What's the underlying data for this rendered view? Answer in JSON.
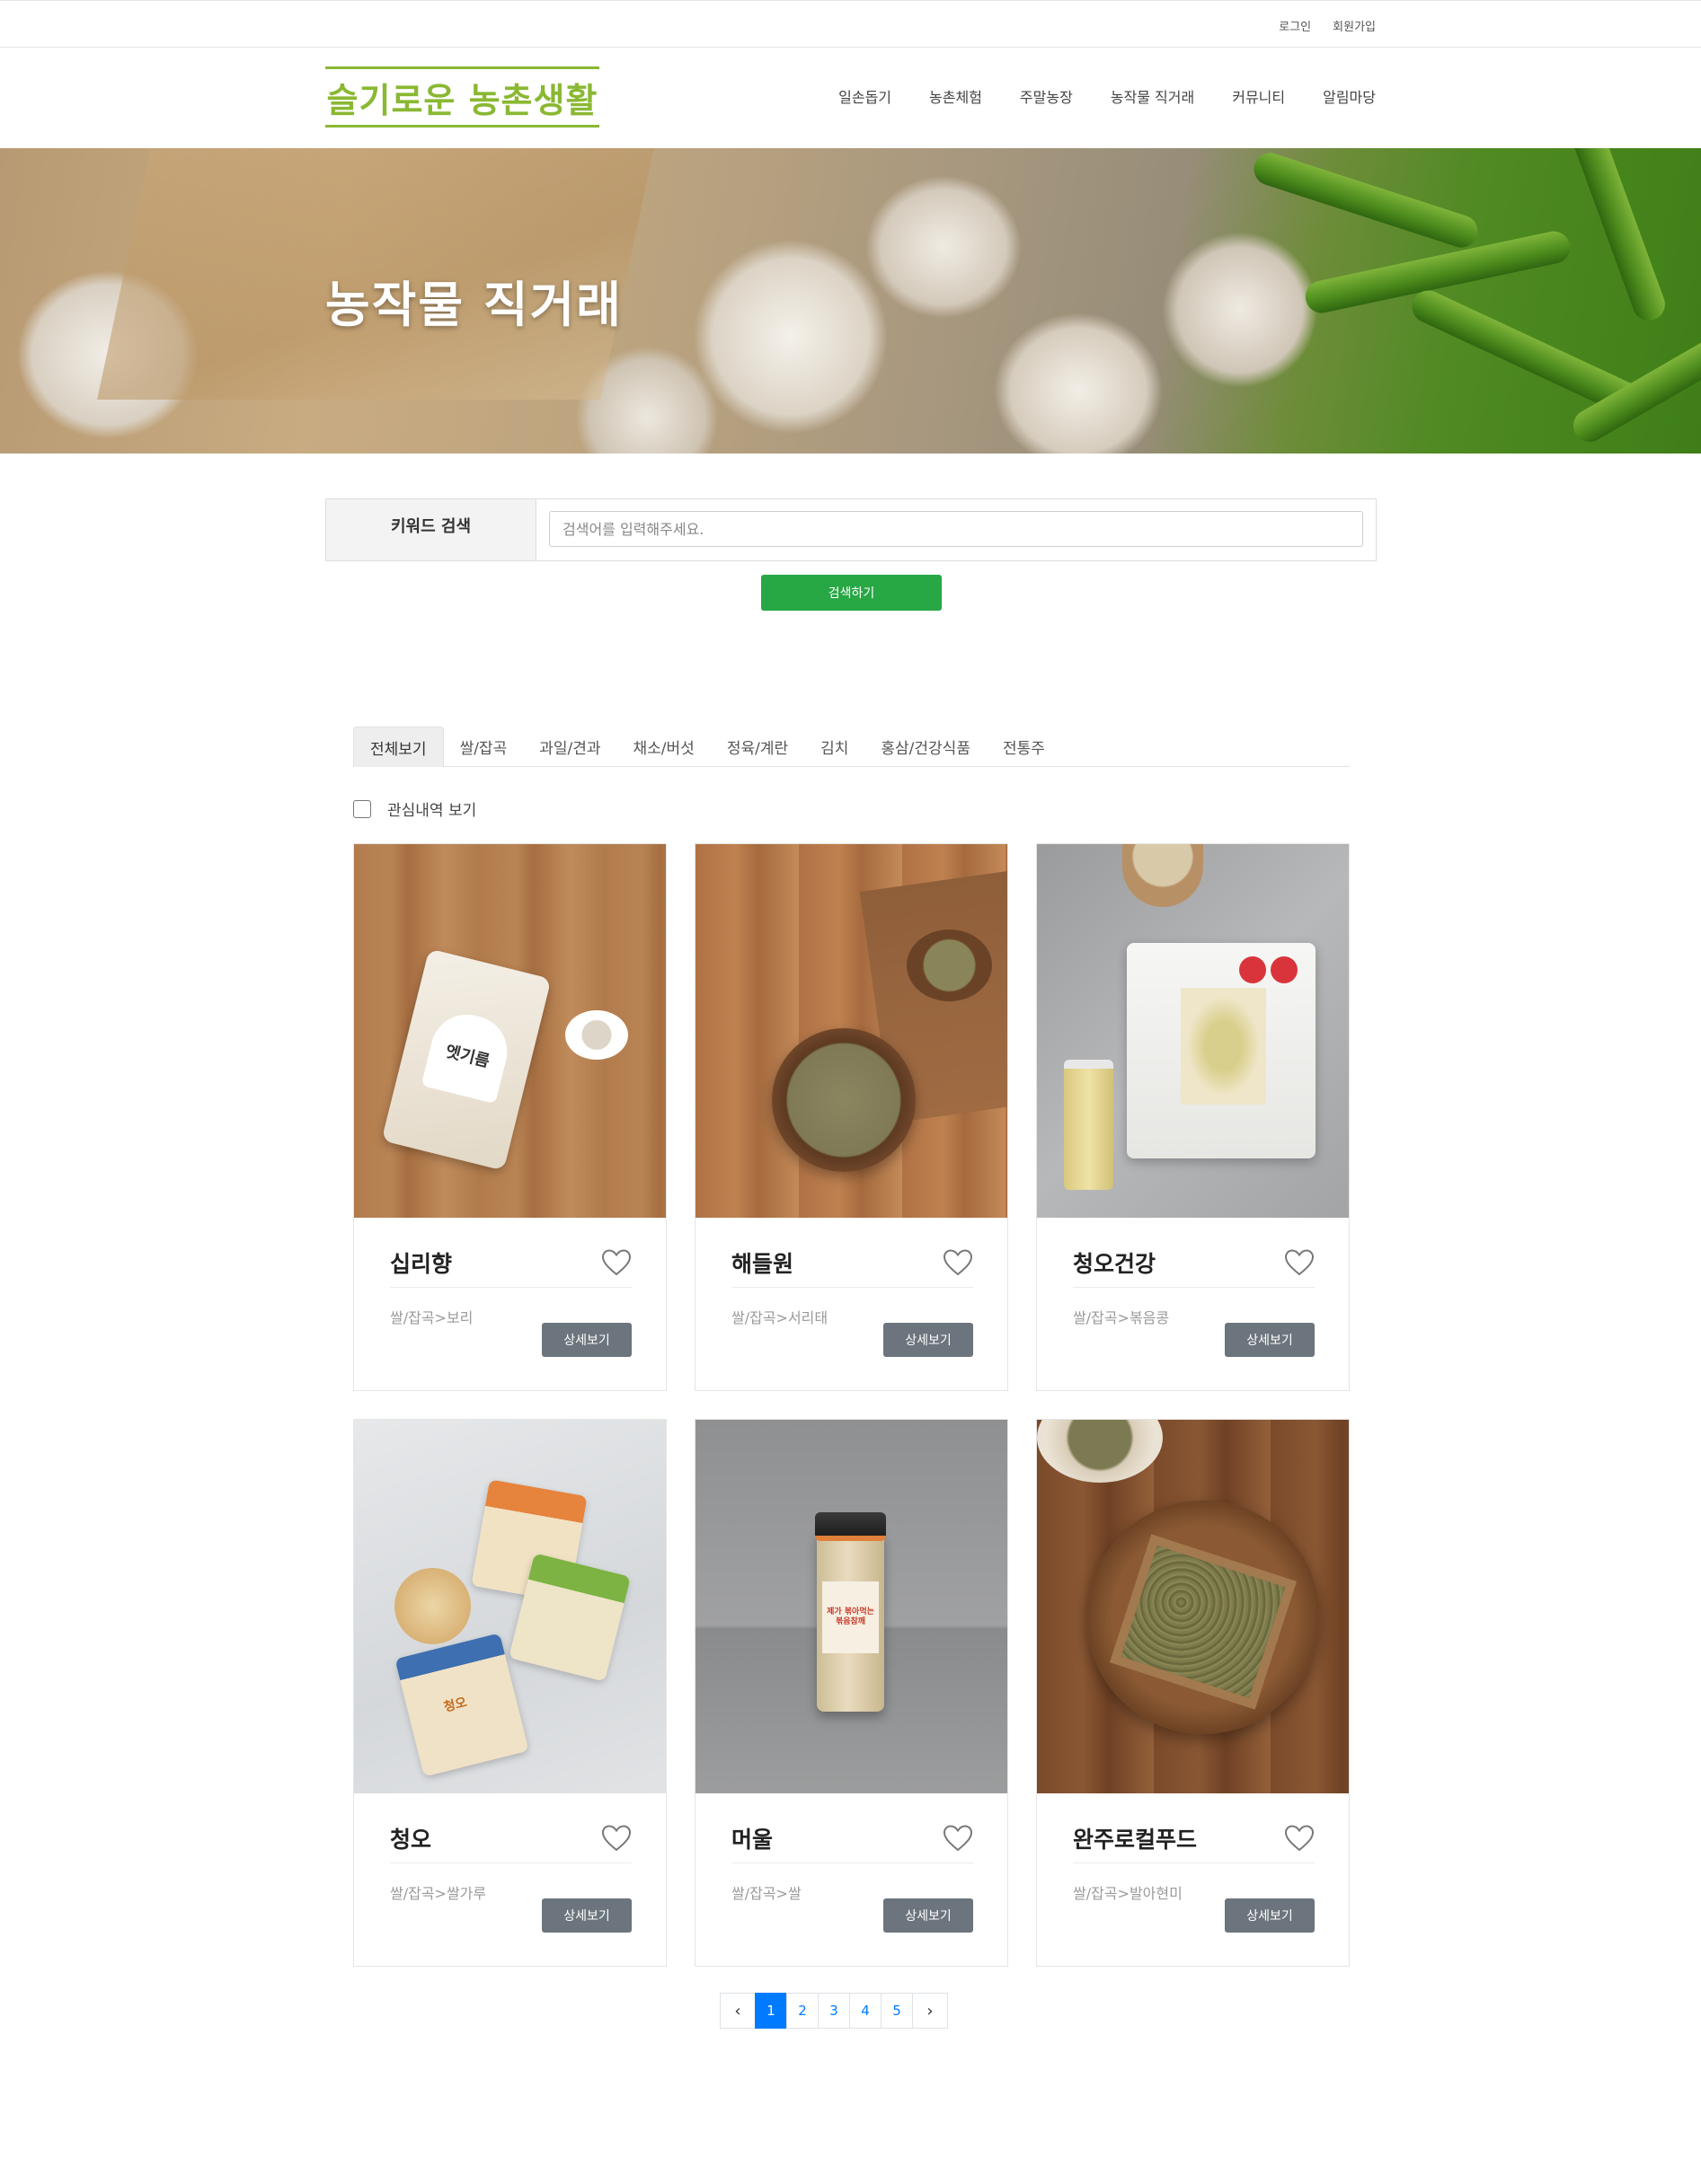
{
  "topbar": {
    "login": "로그인",
    "signup": "회원가입"
  },
  "header": {
    "logo": "슬기로운 농촌생활",
    "nav": [
      "일손돕기",
      "농촌체험",
      "주말농장",
      "농작물 직거래",
      "커뮤니티",
      "알림마당"
    ]
  },
  "hero": {
    "title": "농작물 직거래"
  },
  "search": {
    "label": "키워드 검색",
    "placeholder": "검색어를 입력해주세요.",
    "button": "검색하기"
  },
  "tabs": [
    "전체보기",
    "쌀/잡곡",
    "과일/견과",
    "채소/버섯",
    "정육/계란",
    "김치",
    "홍삼/건강식품",
    "전통주"
  ],
  "interest_label": "관심내역 보기",
  "products": [
    {
      "name": "십리향",
      "category": "쌀/잡곡>보리",
      "button": "상세보기"
    },
    {
      "name": "해들원",
      "category": "쌀/잡곡>서리태",
      "button": "상세보기"
    },
    {
      "name": "청오건강",
      "category": "쌀/잡곡>볶음콩",
      "button": "상세보기"
    },
    {
      "name": "청오",
      "category": "쌀/잡곡>쌀가루",
      "button": "상세보기"
    },
    {
      "name": "머울",
      "category": "쌀/잡곡>쌀",
      "button": "상세보기"
    },
    {
      "name": "완주로컬푸드",
      "category": "쌀/잡곡>발아현미",
      "button": "상세보기"
    }
  ],
  "product_image_text": {
    "p1_package": "엣기름",
    "p4_badge": "청오",
    "p5_label": "제가 볶아먹는 볶음참깨"
  },
  "pagination": {
    "prev": "‹",
    "pages": [
      "1",
      "2",
      "3",
      "4",
      "5"
    ],
    "next": "›",
    "current": "1"
  },
  "colors": {
    "brand": "#8ab833",
    "search_button": "#28a745",
    "detail_button": "#6c757d",
    "page_active": "#007bff"
  },
  "icons": {
    "heart": "heart-outline-icon",
    "checkbox": "checkbox-unchecked",
    "prev": "chevron-left-icon",
    "next": "chevron-right-icon"
  }
}
